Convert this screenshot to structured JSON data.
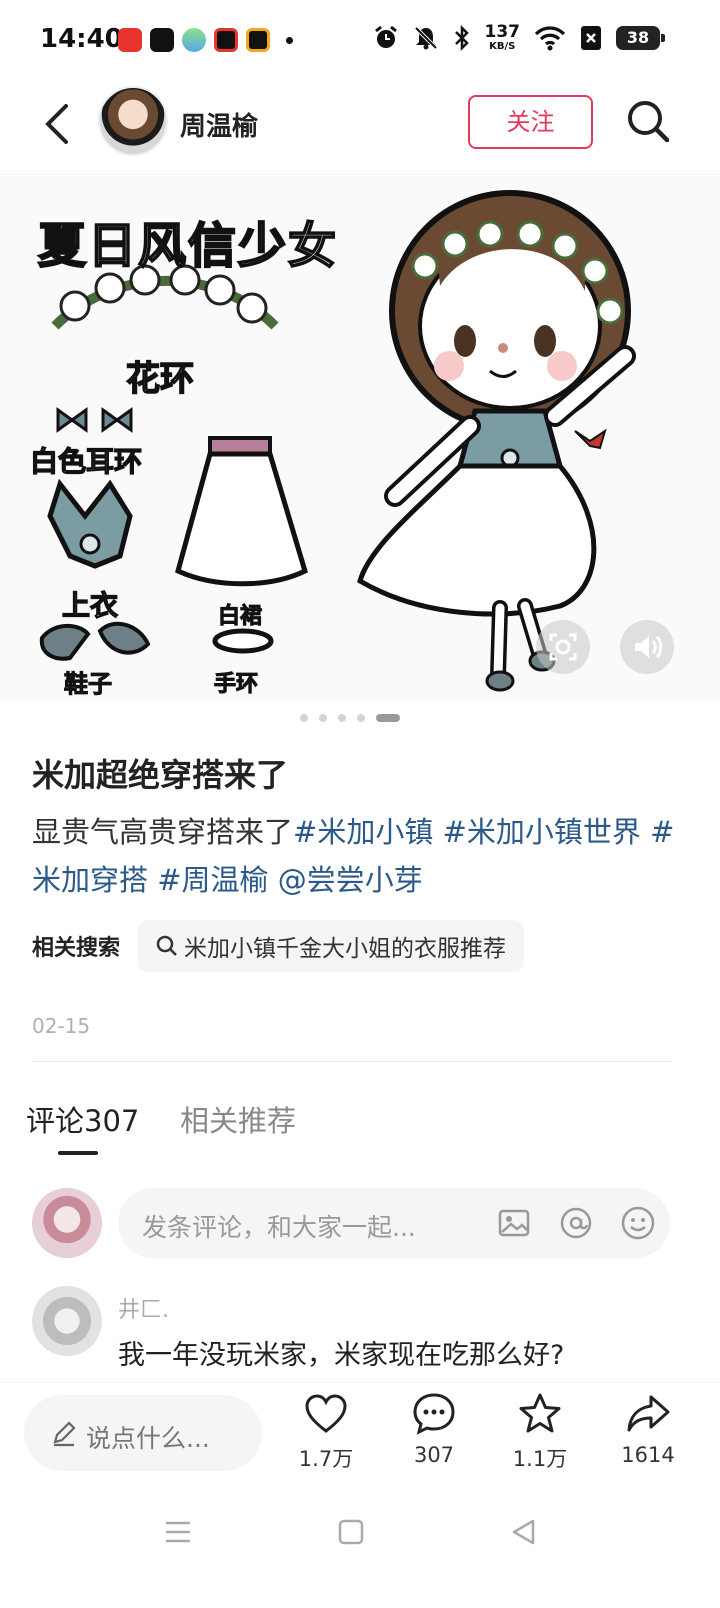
{
  "status_bar": {
    "time": "14:40",
    "net_speed_value": "137",
    "net_speed_unit": "KB/S",
    "battery": "38"
  },
  "header": {
    "author_name": "周温榆",
    "follow_label": "关注"
  },
  "media": {
    "title": "夏日风信少女",
    "labels": {
      "wreath": "花环",
      "earring": "白色耳环",
      "top": "上衣",
      "shoes": "鞋子",
      "skirt": "白裙",
      "bracelet": "手环"
    },
    "page_count": 5,
    "current_page": 5
  },
  "post": {
    "title": "米加超绝穿搭来了",
    "body_text": "显贵气高贵穿搭来了",
    "tags": [
      "#米加小镇",
      "#米加小镇世界",
      "#米加穿搭",
      "#周温榆"
    ],
    "mention": "@尝尝小芽",
    "related_label": "相关搜索",
    "related_query": "米加小镇千金大小姐的衣服推荐",
    "date": "02-15"
  },
  "tabs": {
    "comments": "评论307",
    "related": "相关推荐"
  },
  "comment_input": {
    "placeholder": "发条评论，和大家一起..."
  },
  "comments": [
    {
      "user": "井匚.",
      "text": "我一年没玩米家，米家现在吃那么好?"
    }
  ],
  "bottom_bar": {
    "say_placeholder": "说点什么...",
    "likes": "1.7万",
    "comments": "307",
    "favorites": "1.1万",
    "shares": "1614"
  },
  "colors": {
    "accent": "#e33a5a",
    "tag": "#2b5a8a"
  }
}
